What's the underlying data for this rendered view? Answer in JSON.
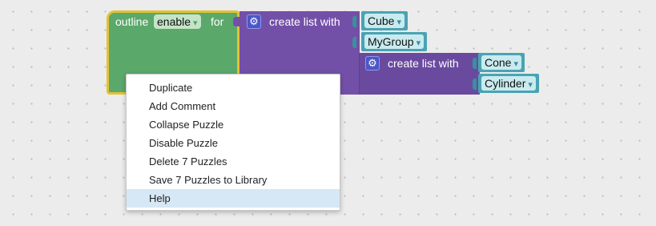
{
  "outline_block": {
    "label_prefix": "outline",
    "mode_value": "enable",
    "label_suffix": "for",
    "dropdown_arrow": "▾"
  },
  "list_outer": {
    "label": "create list with",
    "items": [
      "Cube",
      "MyGroup"
    ]
  },
  "list_inner": {
    "label": "create list with",
    "items": [
      "Cone",
      "Cylinder"
    ]
  },
  "icons": {
    "gear": "⚙"
  },
  "context_menu": {
    "items": [
      "Duplicate",
      "Add Comment",
      "Collapse Puzzle",
      "Disable Puzzle",
      "Delete 7 Puzzles",
      "Save 7 Puzzles to Library",
      "Help"
    ],
    "highlighted": "Help"
  },
  "colors": {
    "outline_block": "#5ba86b",
    "outline_border": "#e3c234",
    "list_block": "#7350a8",
    "value_block": "#4aa3b3",
    "menu_highlight": "#d6e7f5"
  }
}
